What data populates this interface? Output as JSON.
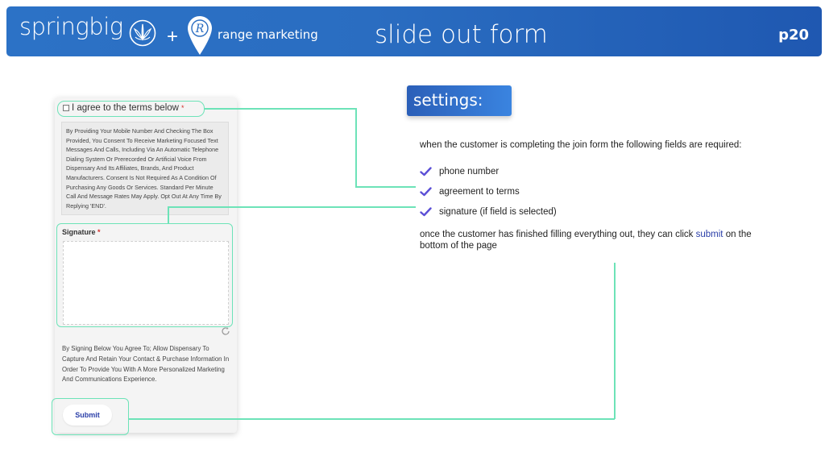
{
  "header": {
    "brand": "springbig",
    "plus": "+",
    "partner": "range marketing",
    "pin_letter": "R",
    "title": "slide out form",
    "page": "p20"
  },
  "form": {
    "agree_label": "I agree to the terms below",
    "required_mark": "*",
    "terms_text": "By Providing Your Mobile Number And Checking The Box Provided, You Consent To Receive Marketing Focused Text Messages And Calls, Including Via An Automatic Telephone Dialing System Or Prerecorded Or Artificial Voice From Dispensary And Its Affiliates, Brands, And Product Manufacturers. Consent Is Not Required As A Condition Of Purchasing Any Goods Or Services. Standard Per Minute Call And Message Rates May Apply. Opt Out At Any Time By Replying 'END'.",
    "signature_label": "Signature",
    "consent_text": "By Signing Below You Agree To; Allow Dispensary To Capture And Retain Your Contact & Purchase Information In Order To Provide You With A More Personalized Marketing And Communications Experience.",
    "submit_label": "Submit"
  },
  "settings": {
    "badge": "settings:",
    "intro": "when the customer is completing the join form  the following fields are required:",
    "items": [
      {
        "label": "phone number"
      },
      {
        "label": "agreement to terms"
      },
      {
        "label": "signature (if field is selected)"
      }
    ],
    "outro_prefix": "once the customer has finished filling everything out, they can click ",
    "outro_link": "submit",
    "outro_suffix": " on the bottom of the page"
  },
  "colors": {
    "banner": "#2a6dc1",
    "highlight": "#6de3b8",
    "check": "#5b4fd6",
    "link": "#2a3ea8"
  },
  "icons": [
    "cannabis-leaf-icon",
    "location-pin-icon",
    "checkbox-icon",
    "refresh-icon",
    "check-icon"
  ]
}
